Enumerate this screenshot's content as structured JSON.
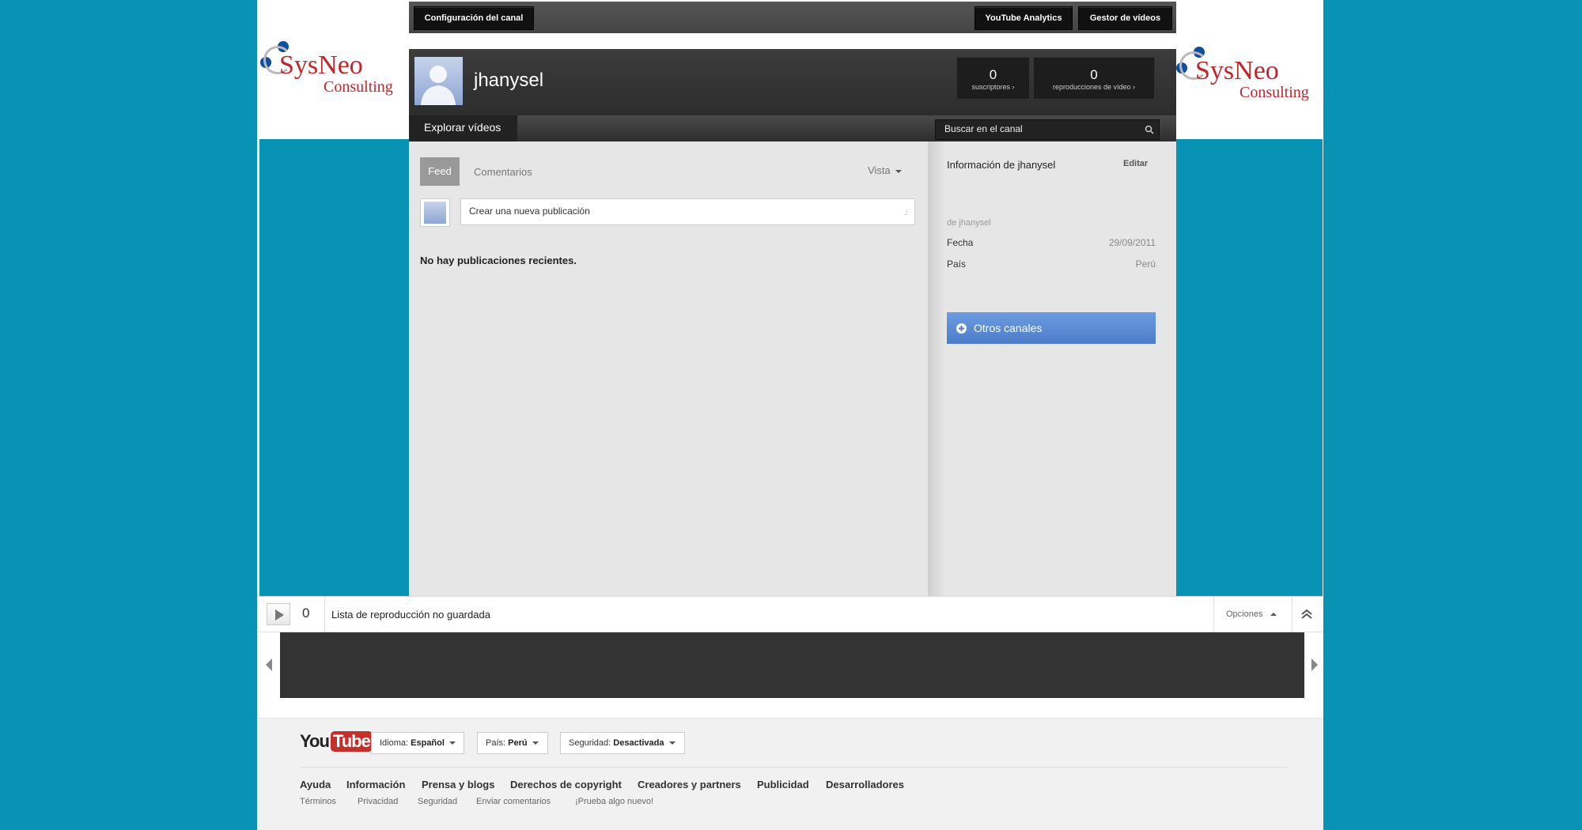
{
  "topbar": {
    "channel_settings": "Configuración del canal",
    "analytics": "YouTube Analytics",
    "video_manager": "Gestor de vídeos"
  },
  "logos": [
    {
      "name": "SysNeo",
      "sub": "Consulting"
    },
    {
      "name": "SysNeo",
      "sub": "Consulting"
    }
  ],
  "channel": {
    "name": "jhanysel",
    "stats": [
      {
        "value": "0",
        "label": "suscriptores ›"
      },
      {
        "value": "0",
        "label": "reproducciones de vídeo ›"
      }
    ],
    "explore_tab": "Explorar vídeos",
    "search_placeholder": "Buscar en el canal"
  },
  "feed": {
    "tabs": [
      "Feed",
      "Comentarios"
    ],
    "view_label": "Vista",
    "new_post_placeholder": "Crear una nueva publicación",
    "empty_message": "No hay publicaciones recientes."
  },
  "sidebar": {
    "title": "Información de jhanysel",
    "edit_label": "Editar",
    "by_line": "de jhanysel",
    "rows": [
      {
        "label": "Fecha",
        "value": "29/09/2011"
      },
      {
        "label": "País",
        "value": "Perú"
      }
    ],
    "other_channels": "Otros canales"
  },
  "playlist": {
    "count": "0",
    "title": "Lista de reproducción no guardada",
    "options_label": "Opciones"
  },
  "footer": {
    "logo_you": "You",
    "logo_tube": "Tube",
    "selects": [
      {
        "label": "Idioma:",
        "value": "Español"
      },
      {
        "label": "País:",
        "value": "Perú"
      },
      {
        "label": "Seguridad:",
        "value": "Desactivada"
      }
    ],
    "links": [
      "Ayuda",
      "Información",
      "Prensa y blogs",
      "Derechos de copyright",
      "Creadores y partners",
      "Publicidad",
      "Desarrolladores"
    ],
    "links2": [
      "Términos",
      "Privacidad",
      "Seguridad",
      "Enviar comentarios",
      "¡Prueba algo nuevo!"
    ]
  },
  "colors": {
    "background": "#0893b4",
    "accent_blue": "#4c7cc8",
    "youtube_red": "#c4302b"
  }
}
